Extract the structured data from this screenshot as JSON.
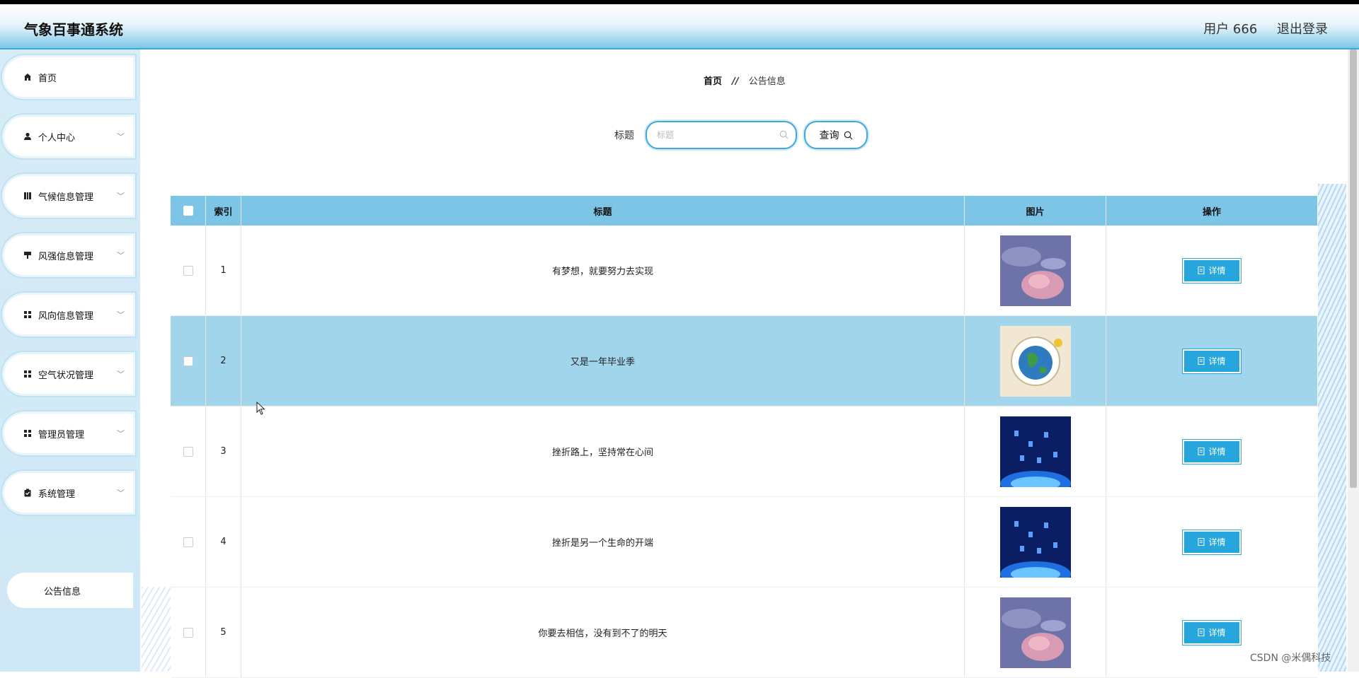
{
  "header": {
    "app_title": "气象百事通系统",
    "user_label": "用户 666",
    "logout_label": "退出登录"
  },
  "sidebar": {
    "items": [
      {
        "label": "首页",
        "icon": "home-icon",
        "expandable": false
      },
      {
        "label": "个人中心",
        "icon": "user-icon",
        "expandable": true
      },
      {
        "label": "气候信息管理",
        "icon": "book-icon",
        "expandable": true
      },
      {
        "label": "风强信息管理",
        "icon": "brush-icon",
        "expandable": true
      },
      {
        "label": "风向信息管理",
        "icon": "grid-icon",
        "expandable": true
      },
      {
        "label": "空气状况管理",
        "icon": "grid-icon",
        "expandable": true
      },
      {
        "label": "管理员管理",
        "icon": "grid-icon",
        "expandable": true
      },
      {
        "label": "系统管理",
        "icon": "clipboard-icon",
        "expandable": true
      }
    ],
    "sub_item": "公告信息"
  },
  "breadcrumb": {
    "home": "首页",
    "separator": "//",
    "current": "公告信息"
  },
  "search": {
    "label": "标题",
    "placeholder": "标题",
    "value": "",
    "button_label": "查询"
  },
  "table": {
    "headers": {
      "index": "索引",
      "title": "标题",
      "image": "图片",
      "action": "操作"
    },
    "rows": [
      {
        "index": "1",
        "title": "有梦想，就要努力去实现",
        "image": "satellite-cloud",
        "action": "详情"
      },
      {
        "index": "2",
        "title": "又是一年毕业季",
        "image": "earth-globe",
        "action": "详情"
      },
      {
        "index": "3",
        "title": "挫折路上，坚持常在心间",
        "image": "blue-tech",
        "action": "详情"
      },
      {
        "index": "4",
        "title": "挫折是另一个生命的开端",
        "image": "blue-tech",
        "action": "详情"
      },
      {
        "index": "5",
        "title": "你要去相信，没有到不了的明天",
        "image": "satellite-cloud",
        "action": "详情"
      }
    ],
    "highlighted_row": 2
  },
  "watermark": "CSDN @米偶科技"
}
